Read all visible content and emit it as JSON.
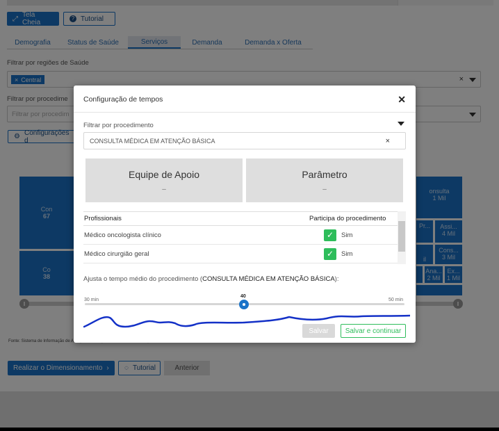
{
  "toolbar": {
    "fullscreen_label": "Tela Cheia",
    "tutorial_label": "Tutorial"
  },
  "tabs": [
    "Demografia",
    "Status de Saúde",
    "Serviços",
    "Demanda",
    "Demanda x Oferta"
  ],
  "active_tab": "Serviços",
  "filters": {
    "regions_label": "Filtrar por regiões de Saúde",
    "region_chip": "Central",
    "procedure_label": "Filtrar por procedime",
    "procedure_placeholder": "Filtrar por procedim",
    "config_button": "Configurações d"
  },
  "treemap": {
    "left_top_label": "Con",
    "left_top_value": "67",
    "left_bottom_label": "Co",
    "left_bottom_value": "38",
    "right_cells": [
      {
        "label": "onsulta",
        "value": "1 Mil"
      },
      {
        "label": "Pr...",
        "value": ""
      },
      {
        "label": "Assi...",
        "value": "4 Mil"
      },
      {
        "label": "Cons...",
        "value": "3 Mil"
      },
      {
        "label": "Ana...",
        "value": "2 Mil"
      },
      {
        "label": "Ex...",
        "value": "1 Mil"
      },
      {
        "label": "il",
        "value": ""
      }
    ]
  },
  "source_text": "Fonte: Sistema de Informação de Atenção Básica (SISAB/DATASUS/CNES)",
  "footer": {
    "dimension_button": "Realizar o Dimensionamento",
    "tutorial_button": "Tutorial",
    "previous_button": "Anterior"
  },
  "modal": {
    "title": "Configuração de tempos",
    "filter_label": "Filtrar por procedimento",
    "selected_procedure": "CONSULTA MÉDICA EM ATENÇÃO BÁSICA",
    "card_support_title": "Equipe de Apoio",
    "card_support_value": "–",
    "card_param_title": "Parâmetro",
    "card_param_value": "–",
    "table": {
      "col_professionals": "Profissionais",
      "col_participates": "Participa do procedimento",
      "rows": [
        {
          "professional": "Médico oncologista clínico",
          "participates": "Sim"
        },
        {
          "professional": "Médico cirurgião geral",
          "participates": "Sim"
        }
      ]
    },
    "adjust_text": "Ajusta o tempo médio do procedimento (",
    "adjust_procedure": "CONSULTA MÉDICA EM ATENÇÃO BÁSICA",
    "adjust_suffix": "):",
    "slider_min": "30 min",
    "slider_max": "50 min",
    "slider_value": "40",
    "save_button": "Salvar",
    "save_continue_button": "Salvar e continuar"
  },
  "colors": {
    "primary": "#1a73c8",
    "success": "#2ebd5b",
    "overlay": "rgba(0,0,0,0.5)"
  }
}
